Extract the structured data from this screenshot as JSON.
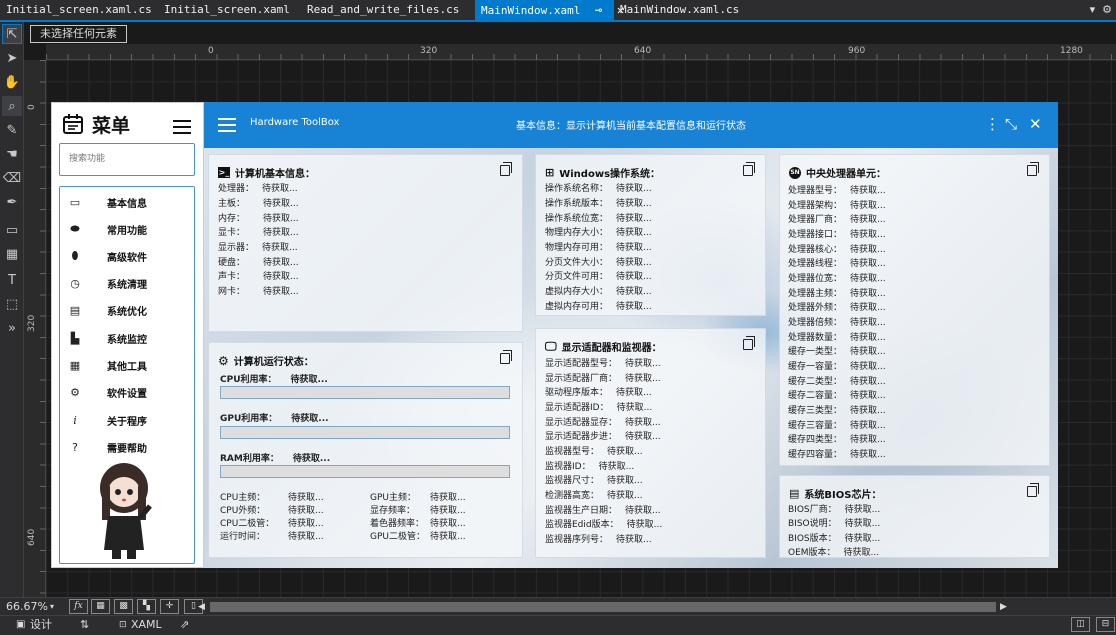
{
  "tabs": [
    {
      "label": "Initial_screen.xaml.cs",
      "active": false
    },
    {
      "label": "Initial_screen.xaml",
      "active": false
    },
    {
      "label": "Read_and_write_files.cs",
      "active": false
    },
    {
      "label": "MainWindow.xaml",
      "active": true,
      "pin": "⊸",
      "close": "✕"
    },
    {
      "label": "MainWindow.xaml.cs",
      "active": false
    }
  ],
  "designer": {
    "selection_hint": "未选择任何元素",
    "ruler_h": [
      "0",
      "320",
      "640",
      "960",
      "1280"
    ],
    "ruler_v": [
      "0",
      "320",
      "640"
    ]
  },
  "menu": {
    "title": "菜单",
    "search_placeholder": "搜索功能",
    "items": [
      {
        "label": "基本信息",
        "icon": "id-card-icon",
        "glyph": "▭"
      },
      {
        "label": "常用功能",
        "icon": "android-icon",
        "glyph": "⬬"
      },
      {
        "label": "高级软件",
        "icon": "bug-icon",
        "glyph": "⬮"
      },
      {
        "label": "系统清理",
        "icon": "clean-icon",
        "glyph": "◷"
      },
      {
        "label": "系统优化",
        "icon": "optimize-icon",
        "glyph": "▤"
      },
      {
        "label": "系统监控",
        "icon": "monitor-bars-icon",
        "glyph": "▙"
      },
      {
        "label": "其他工具",
        "icon": "toolbox-icon",
        "glyph": "▦"
      },
      {
        "label": "软件设置",
        "icon": "settings-icon",
        "glyph": "⚙"
      },
      {
        "label": "关于程序",
        "icon": "info-icon",
        "glyph": "i"
      },
      {
        "label": "需要帮助",
        "icon": "help-icon",
        "glyph": "?"
      }
    ]
  },
  "topbar": {
    "app_name": "Hardware ToolBox",
    "info": "基本信息：显示计算机当前基本配置信息和运行状态"
  },
  "cards": {
    "basic": {
      "title": "计算机基本信息：",
      "rows": [
        {
          "k": "处理器：",
          "v": "待获取..."
        },
        {
          "k": "主板：",
          "v": "待获取..."
        },
        {
          "k": "内存：",
          "v": "待获取..."
        },
        {
          "k": "显卡：",
          "v": "待获取..."
        },
        {
          "k": "显示器：",
          "v": "待获取..."
        },
        {
          "k": "硬盘：",
          "v": "待获取..."
        },
        {
          "k": "声卡：",
          "v": "待获取..."
        },
        {
          "k": "网卡：",
          "v": "待获取..."
        }
      ]
    },
    "status": {
      "title": "计算机运行状态：",
      "bars": [
        {
          "k": "CPU利用率：",
          "v": "待获取..."
        },
        {
          "k": "GPU利用率：",
          "v": "待获取..."
        },
        {
          "k": "RAM利用率：",
          "v": "待获取..."
        }
      ],
      "left": [
        {
          "k": "CPU主频：",
          "v": "待获取..."
        },
        {
          "k": "CPU外频：",
          "v": "待获取..."
        },
        {
          "k": "CPU二极管：",
          "v": "待获取..."
        },
        {
          "k": "运行时间：",
          "v": "待获取..."
        }
      ],
      "right": [
        {
          "k": "GPU主频：",
          "v": "待获取..."
        },
        {
          "k": "显存频率：",
          "v": "待获取..."
        },
        {
          "k": "着色器频率：",
          "v": "待获取..."
        },
        {
          "k": "GPU二极管：",
          "v": "待获取..."
        }
      ]
    },
    "windows": {
      "title": "Windows操作系统：",
      "rows": [
        {
          "k": "操作系统名称：",
          "v": "待获取..."
        },
        {
          "k": "操作系统版本：",
          "v": "待获取..."
        },
        {
          "k": "操作系统位宽：",
          "v": "待获取..."
        },
        {
          "k": "物理内存大小：",
          "v": "待获取..."
        },
        {
          "k": "物理内存可用：",
          "v": "待获取..."
        },
        {
          "k": "分页文件大小：",
          "v": "待获取..."
        },
        {
          "k": "分页文件可用：",
          "v": "待获取..."
        },
        {
          "k": "虚拟内存大小：",
          "v": "待获取..."
        },
        {
          "k": "虚拟内存可用：",
          "v": "待获取..."
        }
      ]
    },
    "display": {
      "title": "显示适配器和监视器：",
      "rows": [
        {
          "k": "显示适配器型号：",
          "v": "待获取..."
        },
        {
          "k": "显示适配器厂商：",
          "v": "待获取..."
        },
        {
          "k": "驱动程序版本：",
          "v": "待获取..."
        },
        {
          "k": "显示适配器ID：",
          "v": "待获取..."
        },
        {
          "k": "显示适配器显存：",
          "v": "待获取..."
        },
        {
          "k": "显示适配器步进：",
          "v": "待获取..."
        },
        {
          "k": "监视器型号：",
          "v": "待获取..."
        },
        {
          "k": "监视器ID：",
          "v": "待获取..."
        },
        {
          "k": "监视器尺寸：",
          "v": "待获取..."
        },
        {
          "k": "检测器高宽：",
          "v": "待获取..."
        },
        {
          "k": "监视器生产日期：",
          "v": "待获取..."
        },
        {
          "k": "监视器Edid版本：",
          "v": "待获取..."
        },
        {
          "k": "监视器序列号：",
          "v": "待获取..."
        }
      ]
    },
    "cpu": {
      "title": "中央处理器单元：",
      "rows": [
        {
          "k": "处理器型号：",
          "v": "待获取..."
        },
        {
          "k": "处理器架构：",
          "v": "待获取..."
        },
        {
          "k": "处理器厂商：",
          "v": "待获取..."
        },
        {
          "k": "处理器接口：",
          "v": "待获取..."
        },
        {
          "k": "处理器核心：",
          "v": "待获取..."
        },
        {
          "k": "处理器线程：",
          "v": "待获取..."
        },
        {
          "k": "处理器位宽：",
          "v": "待获取..."
        },
        {
          "k": "处理器主频：",
          "v": "待获取..."
        },
        {
          "k": "处理器外频：",
          "v": "待获取..."
        },
        {
          "k": "处理器倍频：",
          "v": "待获取..."
        },
        {
          "k": "处理器数量：",
          "v": "待获取..."
        },
        {
          "k": "缓存一类型：",
          "v": "待获取..."
        },
        {
          "k": "缓存一容量：",
          "v": "待获取..."
        },
        {
          "k": "缓存二类型：",
          "v": "待获取..."
        },
        {
          "k": "缓存二容量：",
          "v": "待获取..."
        },
        {
          "k": "缓存三类型：",
          "v": "待获取..."
        },
        {
          "k": "缓存三容量：",
          "v": "待获取..."
        },
        {
          "k": "缓存四类型：",
          "v": "待获取..."
        },
        {
          "k": "缓存四容量：",
          "v": "待获取..."
        }
      ]
    },
    "bios": {
      "title": "系统BIOS芯片：",
      "rows": [
        {
          "k": "BIOS厂商：",
          "v": "待获取..."
        },
        {
          "k": "BISO说明：",
          "v": "待获取..."
        },
        {
          "k": "BIOS版本：",
          "v": "待获取..."
        },
        {
          "k": "OEM版本：",
          "v": "待获取..."
        }
      ]
    }
  },
  "statusbar": {
    "zoom": "66.67%",
    "fx": "fx",
    "design_tab": "设计",
    "swap": "⇅",
    "xaml_tab": "XAML"
  },
  "colors": {
    "accent": "#007acc",
    "app_bar": "#1882d4"
  }
}
